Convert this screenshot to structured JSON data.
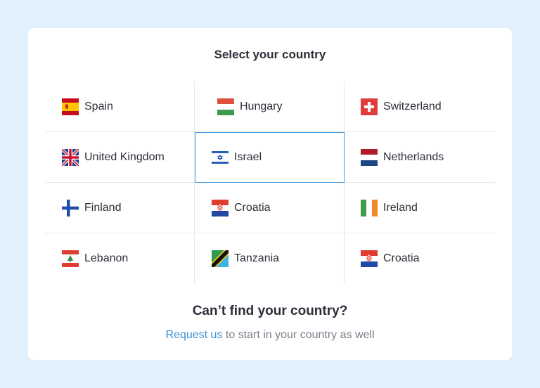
{
  "title": "Select your country",
  "countries": [
    {
      "name": "Spain",
      "flag": "spain-flag-icon"
    },
    {
      "name": "Hungary",
      "flag": "hungary-flag-icon"
    },
    {
      "name": "Switzerland",
      "flag": "switzerland-flag-icon"
    },
    {
      "name": "United Kingdom",
      "flag": "uk-flag-icon"
    },
    {
      "name": "Israel",
      "flag": "israel-flag-icon",
      "selected": true
    },
    {
      "name": "Netherlands",
      "flag": "netherlands-flag-icon"
    },
    {
      "name": "Finland",
      "flag": "finland-flag-icon"
    },
    {
      "name": "Croatia",
      "flag": "croatia-flag-icon"
    },
    {
      "name": "Ireland",
      "flag": "ireland-flag-icon"
    },
    {
      "name": "Lebanon",
      "flag": "lebanon-flag-icon"
    },
    {
      "name": "Tanzania",
      "flag": "tanzania-flag-icon"
    },
    {
      "name": "Croatia",
      "flag": "croatia-flag-icon"
    }
  ],
  "footer": {
    "heading": "Can’t find your country?",
    "link": "Request us",
    "text": " to start in your country as well"
  },
  "colors": {
    "background": "#e3f0fd",
    "card": "#ffffff",
    "accent": "#3d8fd6",
    "selected_border": "#4c9be0"
  }
}
